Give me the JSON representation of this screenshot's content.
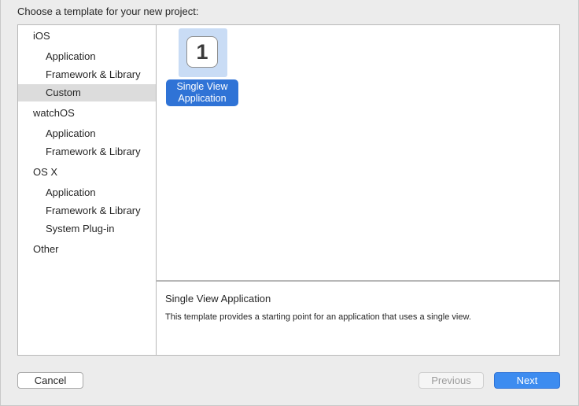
{
  "prompt": "Choose a template for your new project:",
  "sidebar": {
    "items": [
      {
        "label": "iOS"
      },
      {
        "label": "Application"
      },
      {
        "label": "Framework & Library"
      },
      {
        "label": "Custom"
      },
      {
        "label": "watchOS"
      },
      {
        "label": "Application"
      },
      {
        "label": "Framework & Library"
      },
      {
        "label": "OS X"
      },
      {
        "label": "Application"
      },
      {
        "label": "Framework & Library"
      },
      {
        "label": "System Plug-in"
      },
      {
        "label": "Other"
      }
    ]
  },
  "templates": [
    {
      "icon_text": "1",
      "label": "Single View Application"
    }
  ],
  "description": {
    "title": "Single View Application",
    "text": "This template provides a starting point for an application that uses a single view."
  },
  "buttons": {
    "cancel": "Cancel",
    "previous": "Previous",
    "next": "Next"
  },
  "colors": {
    "selection_blue": "#2f73d6",
    "tile_highlight": "#c9dcf5",
    "sidebar_selection": "#dcdcdc"
  }
}
